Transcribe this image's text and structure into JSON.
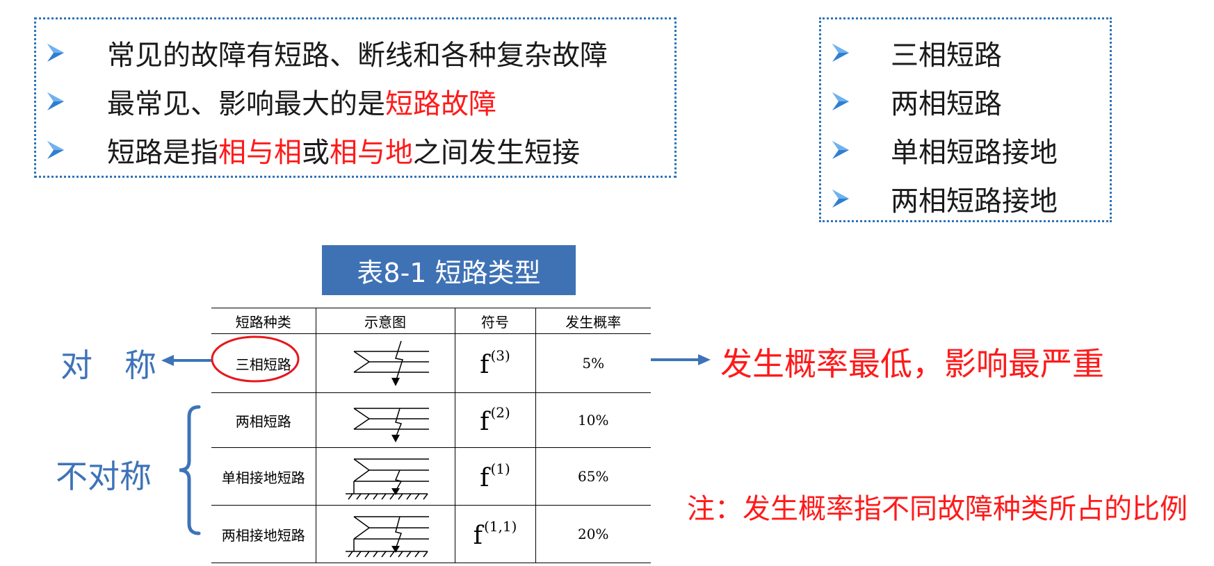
{
  "left_box": {
    "items": [
      {
        "segments": [
          {
            "text": "常见的故障有短路、断线和各种复杂故障",
            "red": false
          }
        ]
      },
      {
        "segments": [
          {
            "text": "最常见、影响最大的是",
            "red": false
          },
          {
            "text": "短路故障",
            "red": true
          }
        ]
      },
      {
        "segments": [
          {
            "text": "短路是指",
            "red": false
          },
          {
            "text": "相与相",
            "red": true
          },
          {
            "text": "或",
            "red": false
          },
          {
            "text": "相与地",
            "red": true
          },
          {
            "text": "之间发生短接",
            "red": false
          }
        ]
      }
    ]
  },
  "right_box": {
    "items": [
      "三相短路",
      "两相短路",
      "单相短路接地",
      "两相短路接地"
    ]
  },
  "table": {
    "title": "表8-1 短路类型",
    "headers": [
      "短路种类",
      "示意图",
      "符号",
      "发生概率"
    ],
    "rows": [
      {
        "type": "三相短路",
        "symbol_base": "f",
        "symbol_sup": "(3)",
        "probability": "5%"
      },
      {
        "type": "两相短路",
        "symbol_base": "f",
        "symbol_sup": "(2)",
        "probability": "10%"
      },
      {
        "type": "单相接地短路",
        "symbol_base": "f",
        "symbol_sup": "(1)",
        "probability": "65%"
      },
      {
        "type": "两相接地短路",
        "symbol_base": "f",
        "symbol_sup": "(1,1)",
        "probability": "20%"
      }
    ]
  },
  "annotations": {
    "symmetric": "对　称",
    "asymmetric": "不对称",
    "lowest_probability": "发生概率最低，影响最严重",
    "note": "注：发生概率指不同故障种类所占的比例"
  },
  "colors": {
    "accent_blue": "#3f72b5",
    "text_blue": "#3d73b8",
    "emphasis_red": "#ff1a1a",
    "border_dotted": "#2f74b5"
  },
  "icons": {
    "bullet": "arrowhead-bullet-icon",
    "arrow_left": "arrow-left-icon",
    "arrow_right": "arrow-right-icon",
    "brace": "left-brace-icon"
  }
}
